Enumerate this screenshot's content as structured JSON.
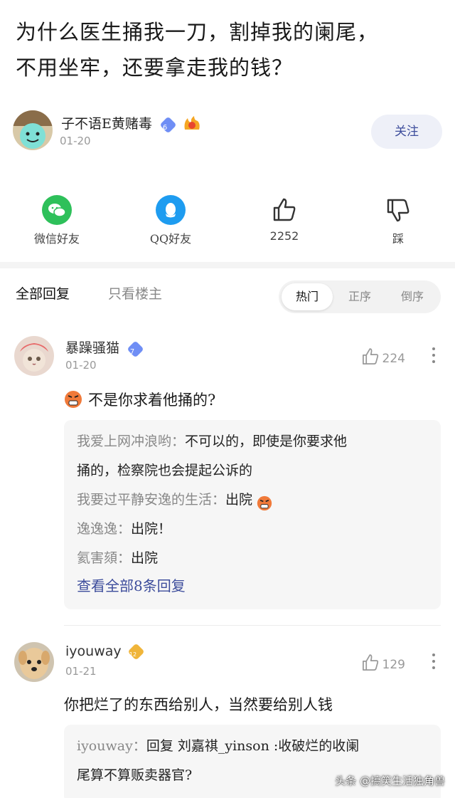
{
  "post": {
    "title_line1": "为什么医生捅我一刀，割掉我的阑尾，",
    "title_line2": "不用坐牢，还要拿走我的钱？"
  },
  "author": {
    "name": "子不语E黄赌毒",
    "level": "6",
    "date": "01-20",
    "follow_label": "关注"
  },
  "share": {
    "wechat_label": "微信好友",
    "qq_label": "QQ好友",
    "like_count": "2252",
    "dislike_label": "踩"
  },
  "tabs": {
    "all_label": "全部回复",
    "owner_label": "只看楼主",
    "sort_hot": "热门",
    "sort_asc": "正序",
    "sort_desc": "倒序"
  },
  "comments": [
    {
      "name": "暴躁骚猫",
      "level": "7",
      "date": "01-20",
      "likes": "224",
      "text": "不是你求着他捅的?",
      "replies": [
        {
          "who": "我爱上网冲浪哟：",
          "text": "不可以的，即使是你要求他"
        },
        {
          "who": "",
          "text": "捅的，检察院也会提起公诉的"
        },
        {
          "who": "我要过平静安逸的生活：",
          "text": "出院"
        },
        {
          "who": "逸逸逸：",
          "text": "出院！"
        },
        {
          "who": "氦害頦：",
          "text": "出院"
        }
      ],
      "more_label": "查看全部8条回复"
    },
    {
      "name": "iyouway",
      "level": "12",
      "date": "01-21",
      "likes": "129",
      "text": "你把烂了的东西给别人，当然要给别人钱",
      "replies": [
        {
          "who": "iyouway：",
          "text": "回复 刘嘉祺_yinson :收破烂的收阑"
        },
        {
          "who": "",
          "text": "尾算不算贩卖器官?"
        }
      ]
    }
  ],
  "watermark": "头条 @搞笑生活独角兽",
  "colors": {
    "accent": "#3d4d9c",
    "wechat": "#2ec05a",
    "qq": "#1e9cf0",
    "level_blue": "#6f8ef5",
    "level_gold": "#f0b53a"
  }
}
